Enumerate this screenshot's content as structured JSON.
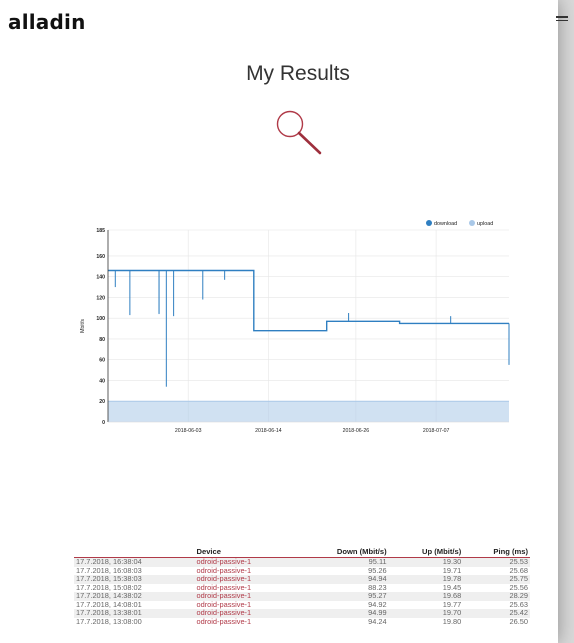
{
  "header": {
    "logo": "alladin",
    "menu_icon": "hamburger-menu-icon"
  },
  "page": {
    "title": "My Results",
    "search_icon": "magnifier-icon"
  },
  "colors": {
    "download": "#2f7fc1",
    "upload": "#a9c8e8",
    "accent": "#b03a48"
  },
  "chart_data": {
    "type": "line",
    "ylabel": "Mbit/s",
    "ylim": [
      0,
      185
    ],
    "yticks": [
      0,
      20,
      40,
      60,
      80,
      100,
      120,
      140,
      160,
      185
    ],
    "xticks": [
      "2018-06-03",
      "2018-06-14",
      "2018-06-26",
      "2018-07-07"
    ],
    "legend": {
      "position": "top-right",
      "entries": [
        "download",
        "upload"
      ]
    },
    "grid": true,
    "series": [
      {
        "name": "download",
        "x": [
          "2018-05-23",
          "2018-06-12",
          "2018-06-12",
          "2018-06-22",
          "2018-06-22",
          "2018-07-02",
          "2018-07-02",
          "2018-07-17"
        ],
        "values": [
          146,
          146,
          88,
          88,
          97,
          97,
          95,
          95
        ],
        "dips": [
          {
            "x": "2018-05-24",
            "value": 130
          },
          {
            "x": "2018-05-26",
            "value": 103
          },
          {
            "x": "2018-05-30",
            "value": 105
          },
          {
            "x": "2018-05-30",
            "value": 104
          },
          {
            "x": "2018-05-31",
            "value": 34
          },
          {
            "x": "2018-06-01",
            "value": 102
          },
          {
            "x": "2018-06-05",
            "value": 118
          },
          {
            "x": "2018-06-08",
            "value": 137
          },
          {
            "x": "2018-06-25",
            "value": 105
          },
          {
            "x": "2018-07-09",
            "value": 102
          },
          {
            "x": "2018-07-17",
            "value": 55
          }
        ]
      },
      {
        "name": "upload",
        "x": [
          "2018-05-23",
          "2018-07-17"
        ],
        "values": [
          20,
          20
        ]
      }
    ]
  },
  "table": {
    "headers": [
      "",
      "Device",
      "Down (Mbit/s)",
      "Up (Mbit/s)",
      "Ping (ms)"
    ],
    "rows": [
      [
        "17.7.2018, 16:38:04",
        "odroid-passive-1",
        "95.11",
        "19.30",
        "25.53"
      ],
      [
        "17.7.2018, 16:08:03",
        "odroid-passive-1",
        "95.26",
        "19.71",
        "25.68"
      ],
      [
        "17.7.2018, 15:38:03",
        "odroid-passive-1",
        "94.94",
        "19.78",
        "25.75"
      ],
      [
        "17.7.2018, 15:08:02",
        "odroid-passive-1",
        "88.23",
        "19.45",
        "25.56"
      ],
      [
        "17.7.2018, 14:38:02",
        "odroid-passive-1",
        "95.27",
        "19.68",
        "28.29"
      ],
      [
        "17.7.2018, 14:08:01",
        "odroid-passive-1",
        "94.92",
        "19.77",
        "25.63"
      ],
      [
        "17.7.2018, 13:38:01",
        "odroid-passive-1",
        "94.99",
        "19.70",
        "25.42"
      ],
      [
        "17.7.2018, 13:08:00",
        "odroid-passive-1",
        "94.24",
        "19.80",
        "26.50"
      ]
    ]
  }
}
